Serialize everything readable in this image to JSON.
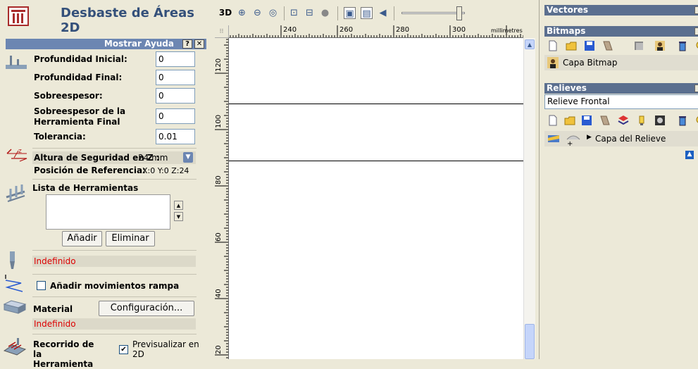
{
  "left_panel": {
    "title": "Desbaste de Áreas 2D",
    "help": {
      "label": "Mostrar Ayuda",
      "question": "?",
      "close": "✕"
    },
    "fields": [
      {
        "label": "Profundidad Inicial:",
        "value": "0"
      },
      {
        "label": "Profundidad Final:",
        "value": "0"
      },
      {
        "label": "Sobreespesor:",
        "value": "0"
      },
      {
        "label": "Sobreespesor de la Herramienta Final",
        "value": "0"
      },
      {
        "label": "Tolerancia:",
        "value": "0.01"
      }
    ],
    "safety": {
      "label": "Altura de Seguridad en Z :",
      "value": "24 mm",
      "ref_label": "Posición de Referencia:",
      "ref_value": "X:0 Y:0 Z:24"
    },
    "tool_list": {
      "label": "Lista de Herramientas",
      "add_button": "Añadir",
      "remove_button": "Eliminar"
    },
    "tool_status": "Indefinido",
    "ramp_checkbox": {
      "label": "Añadir movimientos rampa",
      "checked": false
    },
    "material": {
      "label": "Material",
      "config_button": "Configuración...",
      "status": "Indefinido"
    },
    "toolpath": {
      "label": "Recorrido de la Herramienta",
      "preview_label": "Previsualizar en 2D",
      "preview_checked": true
    }
  },
  "center": {
    "toolbar": {
      "view_3d": "3D"
    },
    "ruler": {
      "units": "millimetres",
      "h_ticks": [
        "240",
        "260",
        "280",
        "300"
      ],
      "v_ticks": [
        "120",
        "100",
        "80",
        "60",
        "40",
        "20"
      ]
    }
  },
  "right_panel": {
    "vectors_header": "Vectores",
    "bitmaps_header": "Bitmaps",
    "bitmap_layer": "Capa Bitmap",
    "reliefs_header": "Relieves",
    "relief_selected": "Relieve Frontal",
    "relief_layer": "Capa del Relieve"
  },
  "colors": {
    "panel_bg": "#ece9d8",
    "header_blue": "#5b6f8f",
    "title_blue": "#34507a",
    "warning_red": "#dd0000"
  }
}
